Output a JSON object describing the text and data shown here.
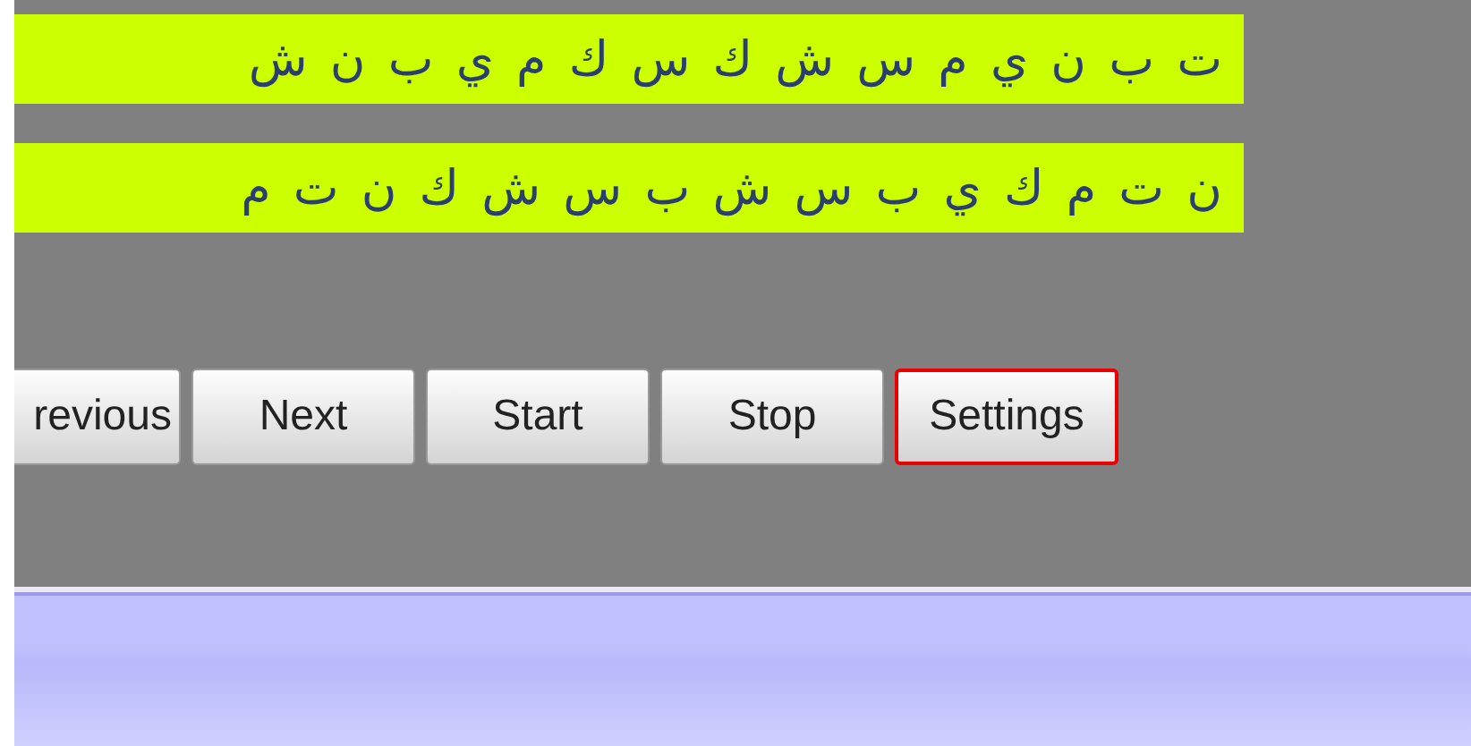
{
  "letter_rows": [
    {
      "text": "ت ب ن ي م س ش ك س ك م ي ب ن ش"
    },
    {
      "text": "ن ت م ك ي ب س ش ب س ش ك ن ت م"
    }
  ],
  "buttons": [
    {
      "label": "revious",
      "selected": false
    },
    {
      "label": "Next",
      "selected": false
    },
    {
      "label": "Start",
      "selected": false
    },
    {
      "label": "Stop",
      "selected": false
    },
    {
      "label": "Settings",
      "selected": true
    }
  ]
}
